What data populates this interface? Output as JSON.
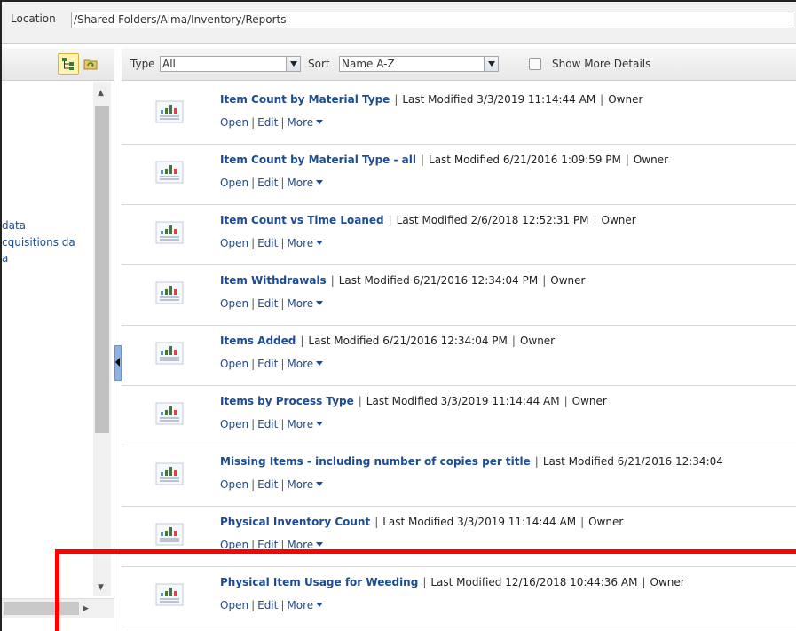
{
  "location": {
    "label": "Location",
    "path": "/Shared Folders/Alma/Inventory/Reports"
  },
  "left_panel": {
    "links": [
      "data",
      "cquisitions da",
      "a"
    ]
  },
  "toolbar": {
    "type_label": "Type",
    "type_value": "All",
    "sort_label": "Sort",
    "sort_value": "Name A-Z",
    "details_label": "Show More Details"
  },
  "actions": {
    "open": "Open",
    "edit": "Edit",
    "more": "More"
  },
  "reports": [
    {
      "name": "Item Count by Material Type",
      "modified": "Last Modified 3/3/2019 11:14:44 AM",
      "owner": "Owner"
    },
    {
      "name": "Item Count by Material Type - all",
      "modified": "Last Modified 6/21/2016 1:09:59 PM",
      "owner": "Owner"
    },
    {
      "name": "Item Count vs Time Loaned",
      "modified": "Last Modified 2/6/2018 12:52:31 PM",
      "owner": "Owner"
    },
    {
      "name": "Item Withdrawals",
      "modified": "Last Modified 6/21/2016 12:34:04 PM",
      "owner": "Owner"
    },
    {
      "name": "Items Added",
      "modified": "Last Modified 6/21/2016 12:34:04 PM",
      "owner": "Owner"
    },
    {
      "name": "Items by Process Type",
      "modified": "Last Modified 3/3/2019 11:14:44 AM",
      "owner": "Owner"
    },
    {
      "name": "Missing Items - including number of copies per title",
      "modified": "Last Modified 6/21/2016 12:34:04",
      "owner": ""
    },
    {
      "name": "Physical Inventory Count",
      "modified": "Last Modified 3/3/2019 11:14:44 AM",
      "owner": "Owner"
    },
    {
      "name": "Physical Item Usage for Weeding",
      "modified": "Last Modified 12/16/2018 10:44:36 AM",
      "owner": "Owner"
    }
  ],
  "colors": {
    "link": "#1b4c94",
    "highlight": "#ff0000"
  }
}
